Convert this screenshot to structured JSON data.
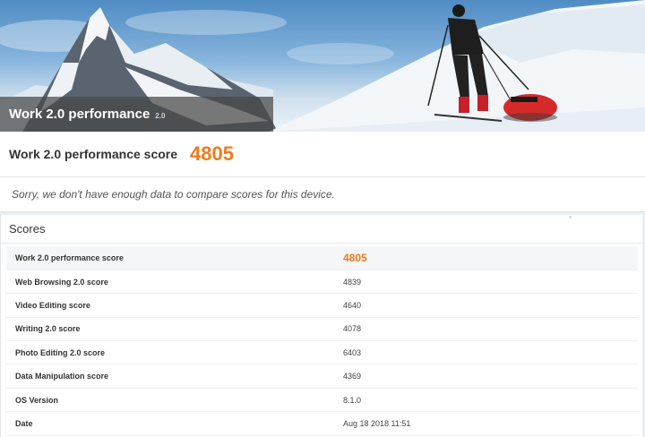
{
  "banner": {
    "title": "Work 2.0 performance",
    "version": "2.0"
  },
  "score_header": {
    "label": "Work 2.0 performance score",
    "value": "4805"
  },
  "notice": {
    "text": "Sorry, we don't have enough data to compare scores for this device."
  },
  "scores": {
    "heading": "Scores",
    "rows": [
      {
        "label": "Work 2.0 performance score",
        "value": "4805"
      },
      {
        "label": "Web Browsing 2.0 score",
        "value": "4839"
      },
      {
        "label": "Video Editing score",
        "value": "4640"
      },
      {
        "label": "Writing 2.0 score",
        "value": "4078"
      },
      {
        "label": "Photo Editing 2.0 score",
        "value": "6403"
      },
      {
        "label": "Data Manipulation score",
        "value": "4369"
      },
      {
        "label": "OS Version",
        "value": "8.1.0"
      },
      {
        "label": "Date",
        "value": "Aug 18 2018 11:51"
      }
    ]
  },
  "colors": {
    "accent": "#f07a1a",
    "banner_bar": "#464646"
  }
}
